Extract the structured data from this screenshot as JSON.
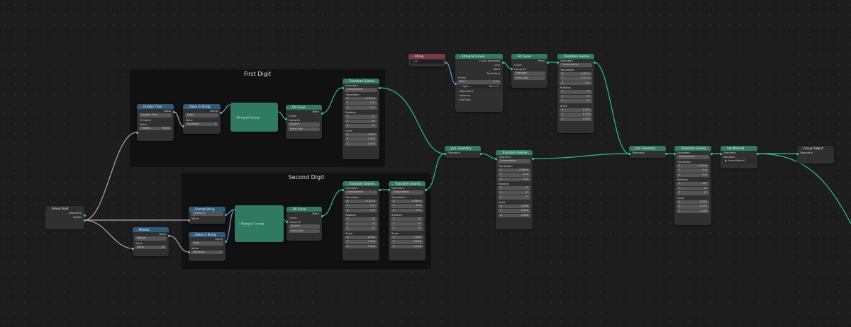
{
  "frames": {
    "first_digit": "First Digit",
    "second_digit": "Second Digit"
  },
  "nodes": {
    "greater_than": {
      "title": "Greater Than",
      "out_value": "Value",
      "operation": "Greater Than",
      "clamp": "Clamp",
      "in_value": "Value",
      "threshold_label": "Thresh...",
      "threshold_value": "9.000"
    },
    "value_to_string_1": {
      "title": "Value to String",
      "out_string": "String",
      "mode": "Float",
      "in_value": "Value",
      "decimals_label": "Decimals",
      "decimals_value": "0"
    },
    "string_to_curves_1": {
      "label": "String to Curves"
    },
    "fill_curve_1": {
      "title": "Fill Curve",
      "out_mesh": "Mesh",
      "curve": "Curve",
      "group_id": "Group ID",
      "mode": "N-gons",
      "fill_rule": "Even-Odd"
    },
    "transform_1": {
      "title": "Transform Geome...",
      "geometry": "Geometry",
      "mode": "Components",
      "translation": "Translation",
      "tx": "-0.01 m",
      "ty": "0 m",
      "tz": "0 m",
      "rotation": "Rotation",
      "rx": "0°",
      "ry": "0°",
      "rz": "0°",
      "scale": "Scale",
      "sx": "1.000",
      "sy": "1.000",
      "sz": "1.000"
    },
    "group_input": {
      "title": "Group Input",
      "geometry": "Geometry",
      "socket": "Socket"
    },
    "format_string": {
      "title": "Format String",
      "format": "{Value:2}",
      "value": "Value"
    },
    "modulo": {
      "title": "Modulo",
      "out_value": "Value",
      "operation": "Modulo",
      "in_value": "Value",
      "value_label": "Value",
      "value_value": "10"
    },
    "value_to_string_2": {
      "title": "Value to String",
      "out_string": "String",
      "mode": "Float",
      "in_value": "Value",
      "decimals_label": "Decimals",
      "decimals_value": "0"
    },
    "string_to_curves_2": {
      "label": "String to Curves"
    },
    "fill_curve_2": {
      "title": "Fill Curve",
      "out_mesh": "Mesh",
      "curve": "Curve",
      "group_id": "Group ID",
      "mode": "N-gons",
      "fill_rule": "Even-Odd"
    },
    "transform_2": {
      "title": "Transform Geome...",
      "geometry": "Geometry",
      "mode": "Components",
      "translation": "Translation",
      "tx": "-0.01 m",
      "ty": "0 m",
      "tz": "0 m",
      "rotation": "Rotation",
      "rx": "0°",
      "ry": "0°",
      "rz": "0°",
      "scale": "Scale",
      "sx": "1.000",
      "sy": "1.000",
      "sz": "1.000"
    },
    "transform_3": {
      "title": "Transform Geome...",
      "geometry": "Geometry",
      "mode": "Components",
      "translation": "Translation",
      "tx": "0.56 m",
      "ty": "0 m",
      "tz": "0 m",
      "rotation": "Rotation",
      "rx": "0°",
      "ry": "0°",
      "rz": "0°",
      "scale": "Scale",
      "sx": "1.000",
      "sy": "1.000",
      "sz": "1.000"
    },
    "string_node": {
      "title": "String",
      "value": "/ 12"
    },
    "string_to_curves_top": {
      "title": "String to Curves",
      "curve_instances": "Curve Instances",
      "line": "Line",
      "word": "Word",
      "pivot_point": "Pivot Point",
      "string": "String",
      "size_label": "Size",
      "size_value": "1 m",
      "font": "Agen...",
      "font_users": "26",
      "alignment": "Alignment",
      "spacing": "Spacing",
      "text_box": "Text Box"
    },
    "fill_curve_top": {
      "title": "Fill Curve",
      "out_mesh": "Mesh",
      "curve": "Curve",
      "group_id": "Group ID",
      "mode": "Triangles",
      "fill_rule": "Even-Odd"
    },
    "transform_top": {
      "title": "Transform Geome...",
      "geometry": "Geometry",
      "mode": "Components",
      "translation": "Translation",
      "tx": "0.55 m",
      "ty": "-0.15 m",
      "tz": "0 m",
      "rotation": "Rotation",
      "rx": "0°",
      "ry": "0°",
      "rz": "0°",
      "scale": "Scale",
      "sx": "0.200",
      "sy": "0.200",
      "sz": "0.500"
    },
    "join_1": {
      "title": "Join Geometry",
      "geometry": "Geometry"
    },
    "transform_4": {
      "title": "Transform Geome...",
      "geometry": "Geometry",
      "mode": "Components",
      "translation": "Translation",
      "tx": "-0.06 m",
      "ty": "0 m",
      "tz": "0 m",
      "rotation": "Rotation",
      "rx": "0°",
      "ry": "0°",
      "rz": "0°",
      "scale": "Scale",
      "sx": "1.000",
      "sy": "1.000",
      "sz": "1.000"
    },
    "join_2": {
      "title": "Join Geometry",
      "geometry": "Geometry"
    },
    "transform_5": {
      "title": "Transform Geome...",
      "geometry": "Geometry",
      "mode": "Components",
      "translation": "Translation",
      "tx": "0.34 m",
      "ty": "0 m",
      "tz": "0 m",
      "rotation": "Rotation",
      "rx": "-49°",
      "ry": "0°",
      "rz": "0°",
      "scale": "Scale",
      "sx": "-0.475",
      "sy": "-0.475",
      "sz": "1.330"
    },
    "set_material": {
      "title": "Set Material",
      "geometry": "Geometry",
      "selection": "Selection",
      "material": "SmartWatchG..."
    },
    "group_output": {
      "title": "Group Output",
      "geometry": "Geometry"
    }
  },
  "colors": {
    "geometry_wire": "#2fbf8f",
    "value_wire": "#a8a8a8",
    "string_wire": "#6c9bd8",
    "background": "#1d1d1d"
  }
}
